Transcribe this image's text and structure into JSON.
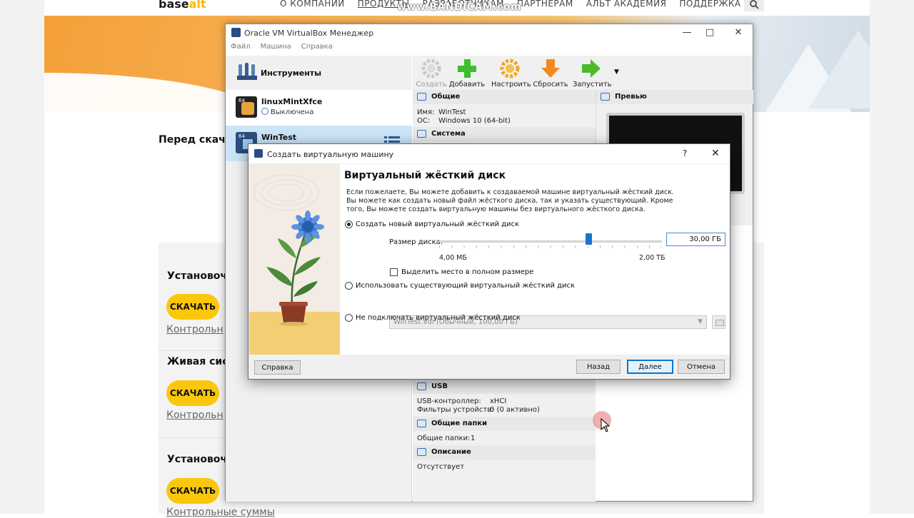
{
  "watermark": "www.BANDICAM.com",
  "site": {
    "logo_main": "base",
    "logo_accent": "alt",
    "nav": [
      "О КОМПАНИИ",
      "ПРОДУКТЫ",
      "РАЗРАБОТЧИКАМ",
      "ПАРТНЕРАМ",
      "АЛЬТ АКАДЕМИЯ",
      "ПОДДЕРЖКА"
    ],
    "before_title": "Перед скачи",
    "cards": [
      {
        "title": "Установочн",
        "button": "СКАЧАТЬ",
        "link": "Контрольн"
      },
      {
        "title": "Живая сис",
        "button": "СКАЧАТЬ",
        "link": "Контрольн"
      },
      {
        "title": "Установочн",
        "button": "СКАЧАТЬ",
        "link": "Контрольные суммы"
      }
    ],
    "accent_color": "#fbc70a"
  },
  "vbox": {
    "title": "Oracle VM VirtualBox Менеджер",
    "menu": [
      "Файл",
      "Машина",
      "Справка"
    ],
    "tools_label": "Инструменты",
    "vms": [
      {
        "name": "linuxMintXfce",
        "state": "Выключена",
        "icon": "linux-mint-icon"
      },
      {
        "name": "WinTest",
        "state": "",
        "icon": "windows-10-icon"
      }
    ],
    "toolbar": [
      {
        "label": "Создать",
        "icon": "create-gear-icon",
        "enabled": false
      },
      {
        "label": "Добавить",
        "icon": "add-plus-icon",
        "enabled": true
      },
      {
        "label": "Настроить",
        "icon": "settings-gear-icon",
        "enabled": true
      },
      {
        "label": "Сбросить",
        "icon": "discard-arrow-icon",
        "enabled": true
      },
      {
        "label": "Запустить",
        "icon": "start-arrow-icon",
        "enabled": true
      }
    ],
    "general": {
      "head": "Общие",
      "name_label": "Имя:",
      "name_value": "WinTest",
      "os_label": "ОС:",
      "os_value": "Windows 10 (64-bit)"
    },
    "system_head": "Система",
    "preview_head": "Превью",
    "usb": {
      "head": "USB",
      "controller_label": "USB-контроллер:",
      "controller_value": "xHCI",
      "filters_label": "Фильтры устройств:",
      "filters_value": "0 (0 активно)"
    },
    "shared": {
      "head": "Общие папки",
      "label": "Общие папки:",
      "value": "1"
    },
    "description": {
      "head": "Описание",
      "value": "Отсутствует"
    }
  },
  "dialog": {
    "title": "Создать виртуальную машину",
    "help": "?",
    "heading": "Виртуальный жёсткий диск",
    "description": "Если пожелаете, Вы можете добавить к создаваемой машине виртуальный жёсткий диск. Вы можете как создать новый файл жёсткого диска, так и указать существующий. Кроме того, Вы можете создать виртуальную машины без виртуального жёсткого диска.",
    "option_create": "Создать новый виртуальный жёсткий диск",
    "size_label": "Размер диска:",
    "size_value": "30,00 ГБ",
    "slider_min": "4,00 МБ",
    "slider_max": "2,00 ТБ",
    "slider_fraction": 0.67,
    "preallocate_label": "Выделить место в полном размере",
    "option_existing": "Использовать существующий виртуальный жёсткий диск",
    "existing_value": "WinTest.vdi (Обычный, 100,00 ГБ)",
    "option_none": "Не подключать виртуальный жёсткий диск",
    "selected_option": "create",
    "btn_help": "Справка",
    "btn_back": "Назад",
    "btn_next": "Далее",
    "btn_cancel": "Отмена"
  }
}
